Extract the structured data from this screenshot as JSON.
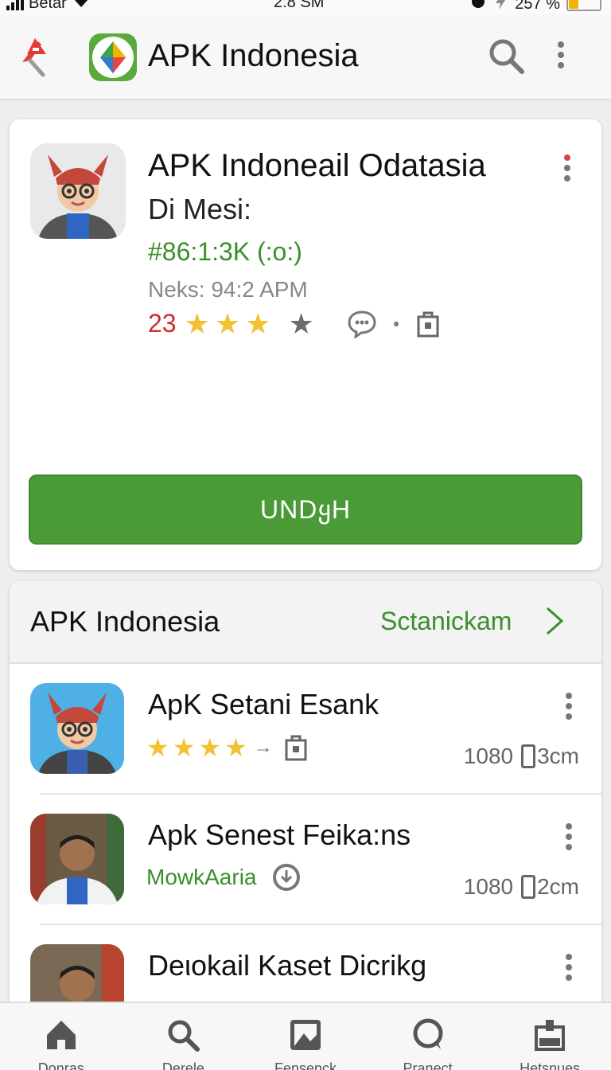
{
  "status_bar": {
    "carrier": "Betar",
    "time": "2:8 SM",
    "battery": "257 %",
    "battery_level": 0.3
  },
  "app_bar": {
    "title": "APK Indonesia"
  },
  "featured": {
    "title": "APK Indoneail Odatasia",
    "subtitle": "Di Mesi:",
    "id_text": "#86:1:3K (:o:)",
    "time_text": "Neks: 94:2 APM",
    "rating_number": "23",
    "stars_filled": 3,
    "download_label": "UNDყH"
  },
  "section": {
    "title": "APK Indonesia",
    "see_all_label": "Sctanickam",
    "items": [
      {
        "title": "ApK Setani Esank",
        "stars": 4,
        "size_num": "1080",
        "size_unit": "3cm",
        "icon": "avatar-cartoon-icon"
      },
      {
        "title": "Apk Senest Feika:ns",
        "developer": "MowkAaria",
        "size_num": "1080",
        "size_unit": "2cm",
        "icon": "avatar-man-icon"
      },
      {
        "title": "Deιokail Kaset Dicrikg",
        "icon": "avatar-man-icon"
      }
    ]
  },
  "bottom_nav": [
    {
      "label": "Donras",
      "icon": "home-icon"
    },
    {
      "label": "Derele",
      "icon": "search-icon"
    },
    {
      "label": "Fensenck",
      "icon": "image-icon"
    },
    {
      "label": "Pranect",
      "icon": "chat-bubble-icon"
    },
    {
      "label": "Hetsnues",
      "icon": "bag-icon"
    }
  ],
  "colors": {
    "accent_green": "#4a9a38",
    "text_green": "#3a8f2c",
    "rating_red": "#d02a2a",
    "star_gold": "#f1c232"
  }
}
